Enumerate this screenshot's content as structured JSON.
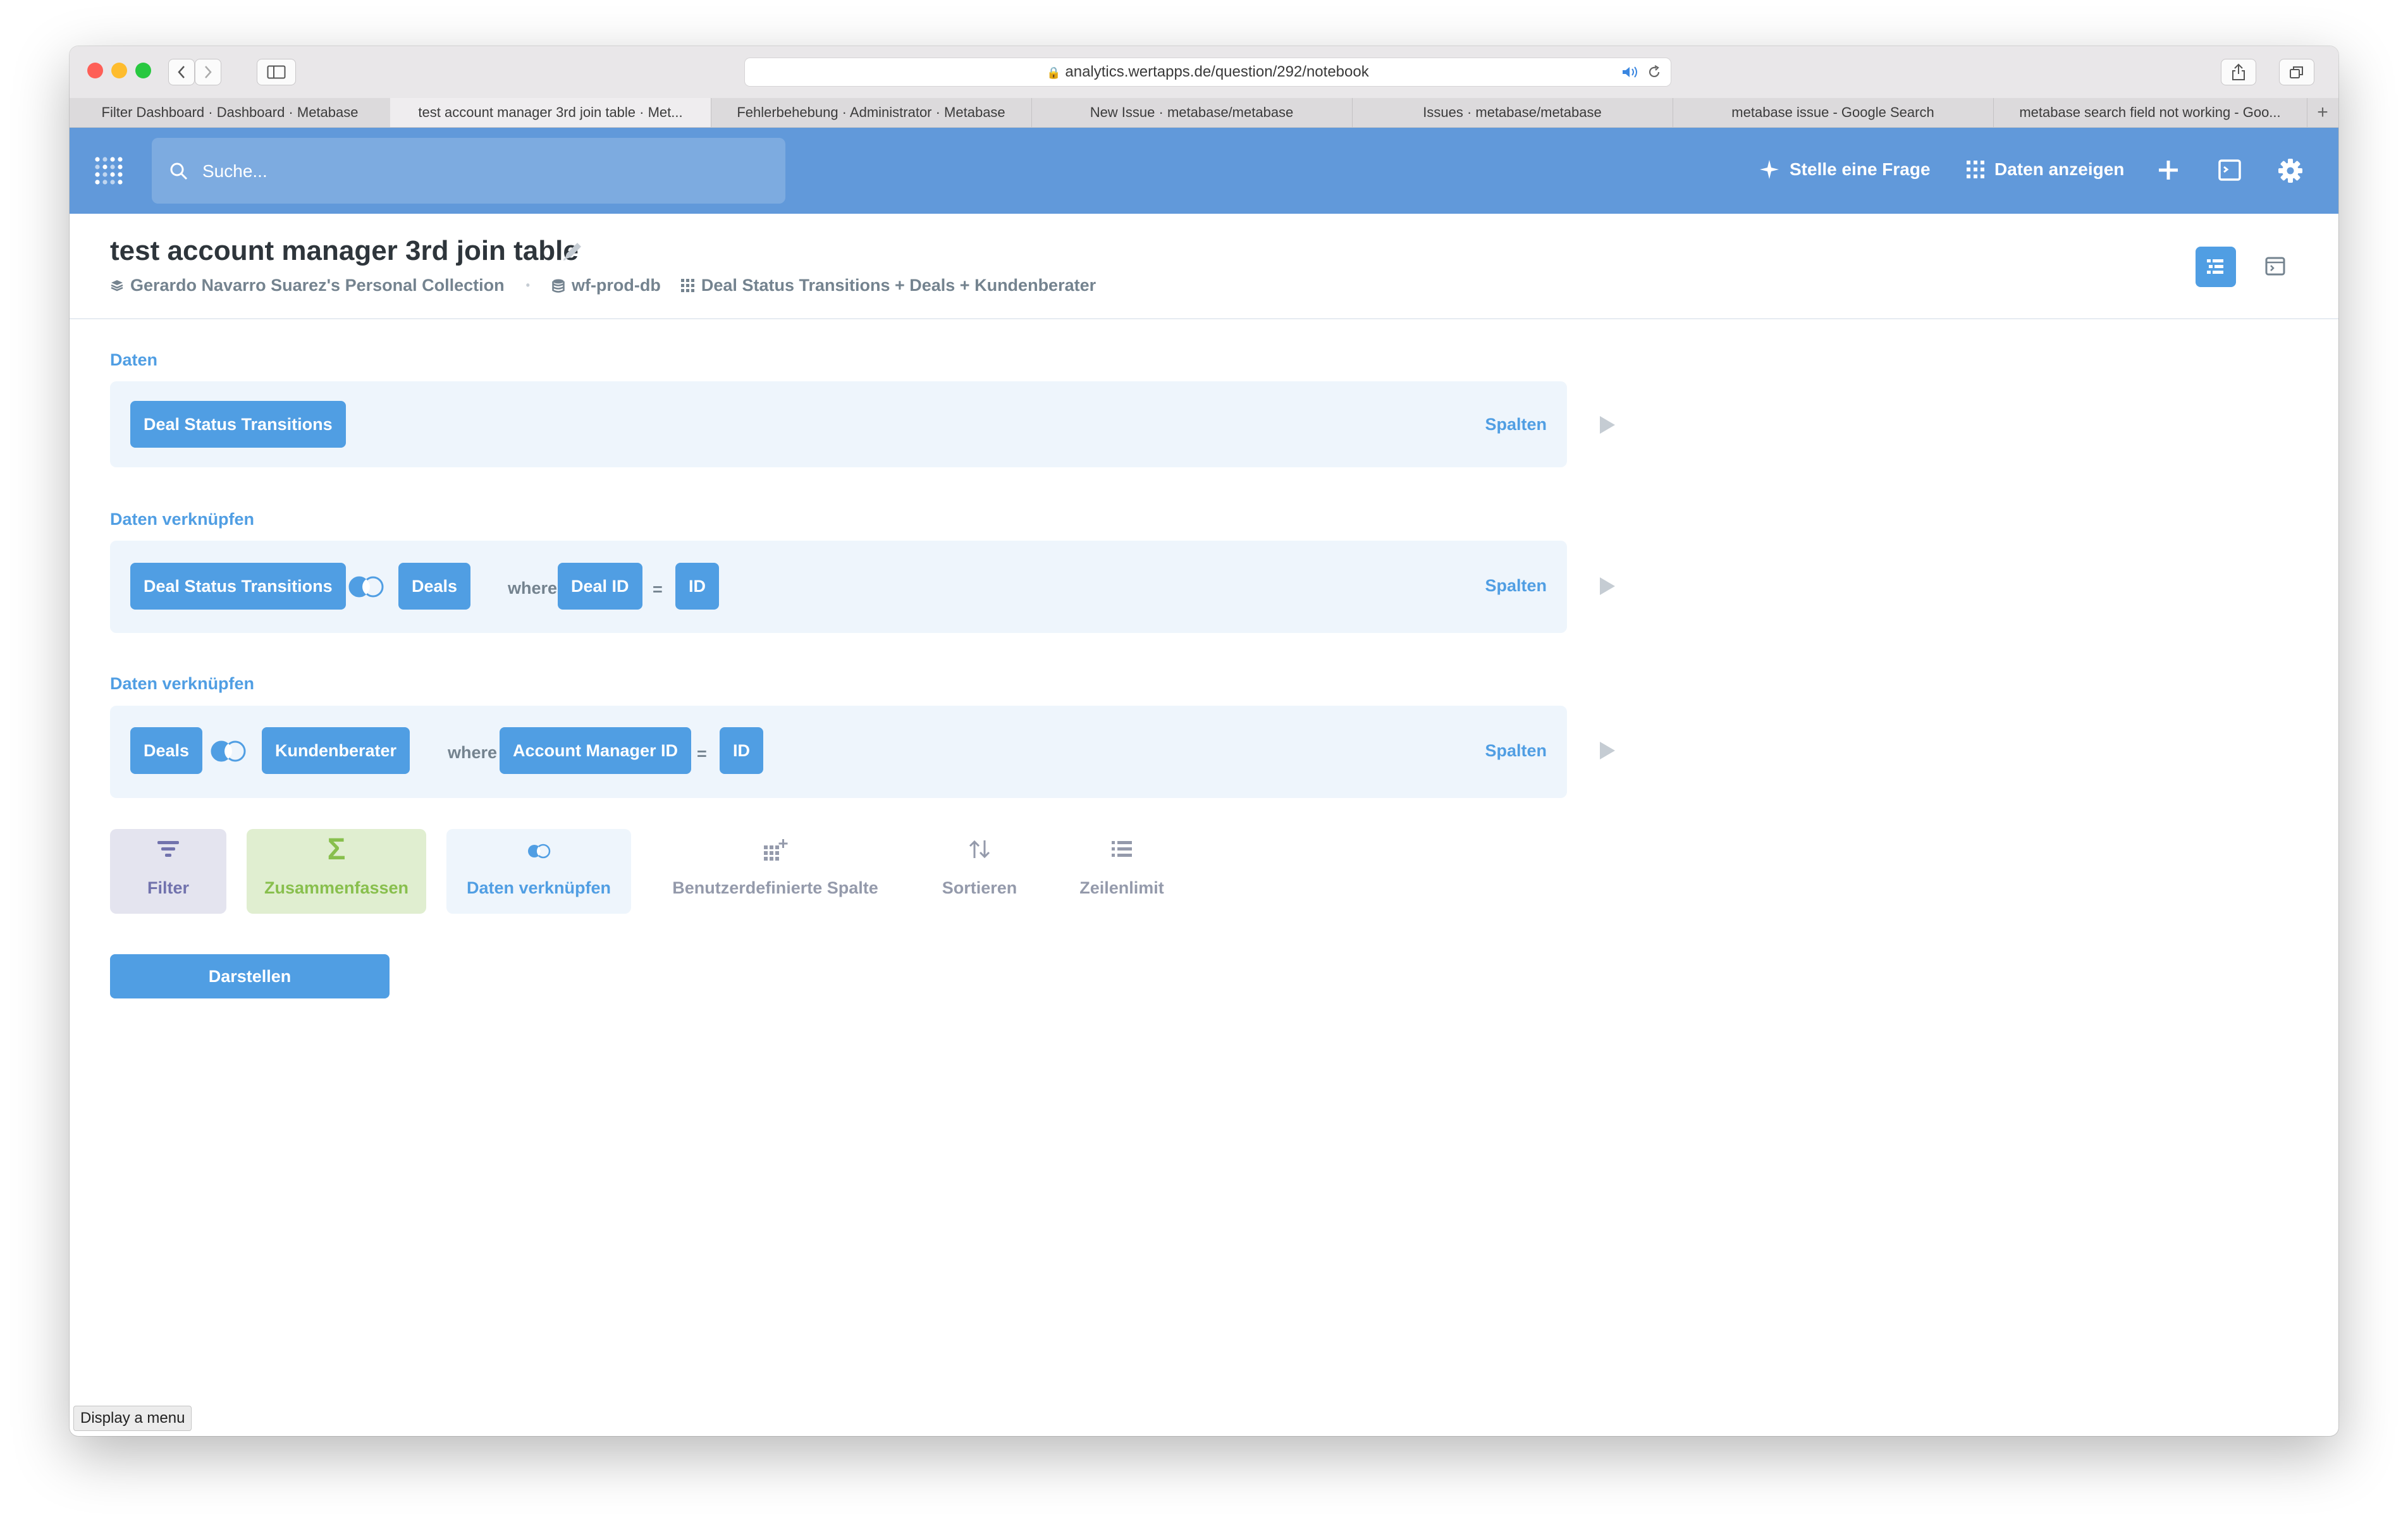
{
  "browser": {
    "url": "analytics.wertapps.de/question/292/notebook",
    "tabs": [
      {
        "label": "Filter Dashboard · Dashboard · Metabase"
      },
      {
        "label": "test account manager 3rd join table · Met..."
      },
      {
        "label": "Fehlerbehebung · Administrator · Metabase"
      },
      {
        "label": "New Issue · metabase/metabase"
      },
      {
        "label": "Issues · metabase/metabase"
      },
      {
        "label": "metabase issue - Google Search"
      },
      {
        "label": "metabase search field not working - Goo..."
      }
    ],
    "active_tab_index": 1
  },
  "nav": {
    "search_placeholder": "Suche...",
    "ask_question": "Stelle eine Frage",
    "browse_data": "Daten anzeigen"
  },
  "question": {
    "title": "test account manager 3rd join table",
    "collection": "Gerardo Navarro Suarez's Personal Collection",
    "database": "wf-prod-db",
    "tables": "Deal Status Transitions + Deals + Kundenberater"
  },
  "steps": {
    "data": {
      "label": "Daten",
      "table": "Deal Status Transitions",
      "columns_label": "Spalten"
    },
    "join1": {
      "label": "Daten verknüpfen",
      "left_table": "Deal Status Transitions",
      "right_table": "Deals",
      "where": "where",
      "left_field": "Deal ID",
      "operator": "=",
      "right_field": "ID",
      "columns_label": "Spalten"
    },
    "join2": {
      "label": "Daten verknüpfen",
      "left_table": "Deals",
      "right_table": "Kundenberater",
      "where": "where",
      "left_field": "Account Manager ID",
      "operator": "=",
      "right_field": "ID",
      "columns_label": "Spalten"
    }
  },
  "actions": {
    "filter": "Filter",
    "summarize": "Zusammenfassen",
    "join": "Daten verknüpfen",
    "custom_column": "Benutzerdefinierte Spalte",
    "sort": "Sortieren",
    "limit": "Zeilenlimit"
  },
  "visualize_button": "Darstellen",
  "status_tooltip": "Display a menu",
  "colors": {
    "brand": "#509ee3",
    "nav_bg": "#6199da",
    "step_bg": "#eef5fc",
    "filter": "#7172ad",
    "summarize": "#88bf4d"
  }
}
